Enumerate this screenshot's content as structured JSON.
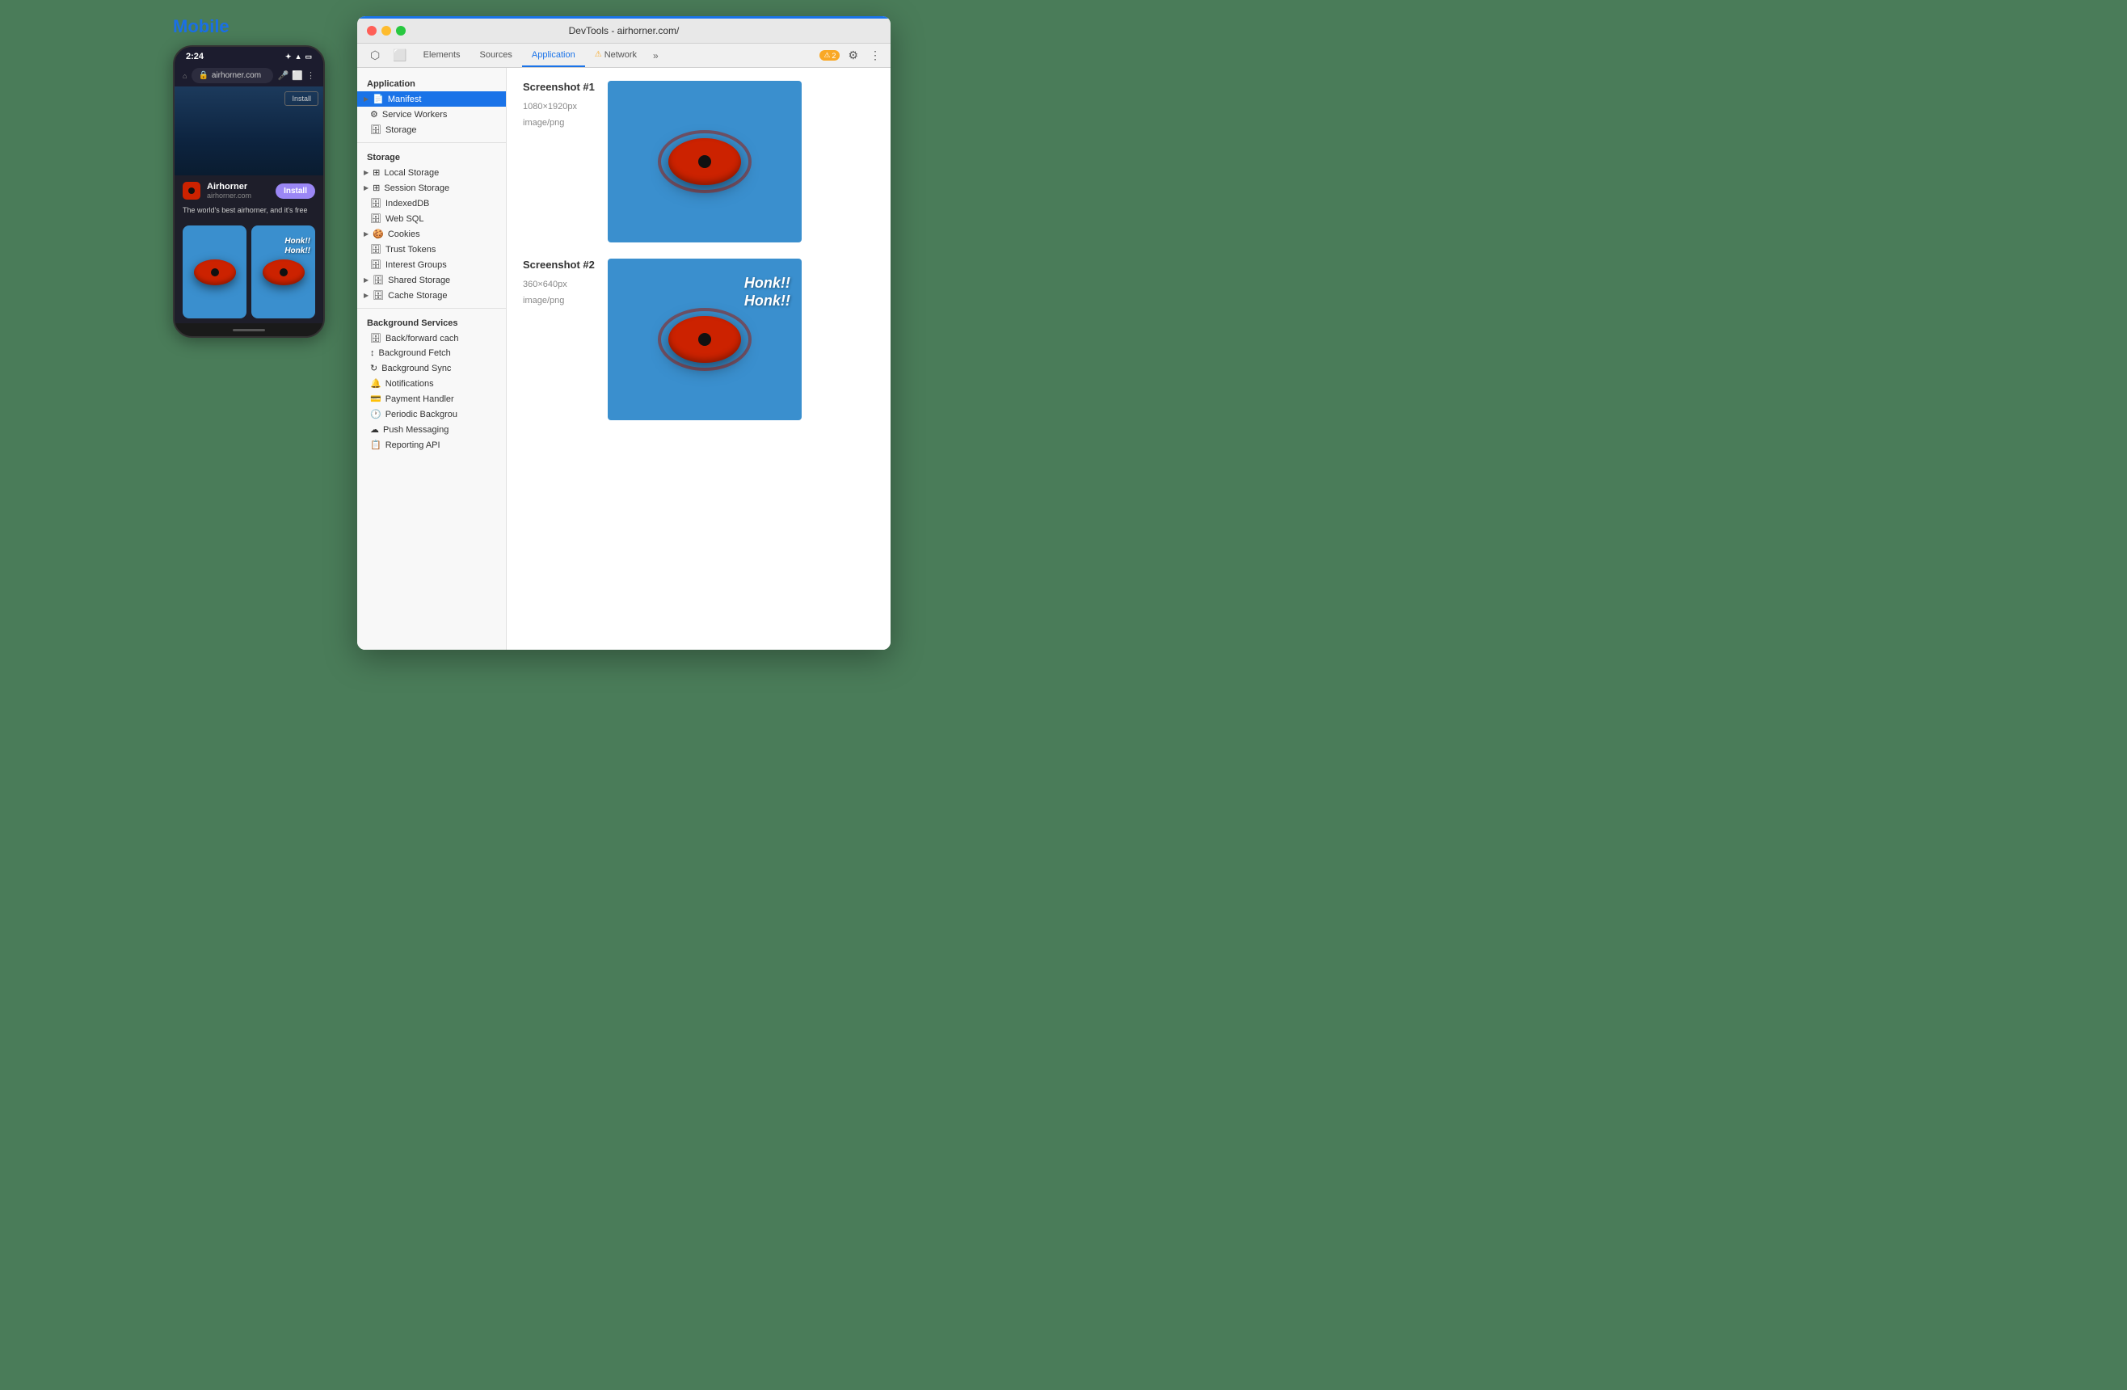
{
  "left": {
    "mobile_label": "Mobile",
    "phone": {
      "time": "2:24",
      "address": "airhorner.com",
      "install_top": "Install",
      "app_name": "Airhorner",
      "app_domain": "airhorner.com",
      "install_btn": "Install",
      "tagline": "The world's best airhorner, and it's free",
      "honk_text": "Honk!!\nHonk!!"
    }
  },
  "devtools": {
    "title": "DevTools - airhorner.com/",
    "tabs": [
      {
        "label": "Elements",
        "active": false
      },
      {
        "label": "Sources",
        "active": false
      },
      {
        "label": "Application",
        "active": true
      },
      {
        "label": "Network",
        "active": false,
        "warning": true
      }
    ],
    "more_tabs": "»",
    "warn_badge": "⚠ 2",
    "sidebar": {
      "sections": [
        {
          "label": "Application",
          "items": [
            {
              "label": "Manifest",
              "icon": "📄",
              "arrow": true,
              "active": true
            },
            {
              "label": "Service Workers",
              "icon": "⚙️",
              "arrow": false
            },
            {
              "label": "Storage",
              "icon": "🗄️",
              "arrow": false
            }
          ]
        },
        {
          "label": "Storage",
          "items": [
            {
              "label": "Local Storage",
              "icon": "▦",
              "arrow": true
            },
            {
              "label": "Session Storage",
              "icon": "▦",
              "arrow": true
            },
            {
              "label": "IndexedDB",
              "icon": "🗄️",
              "arrow": false
            },
            {
              "label": "Web SQL",
              "icon": "🗄️",
              "arrow": false
            },
            {
              "label": "Cookies",
              "icon": "🍪",
              "arrow": true
            },
            {
              "label": "Trust Tokens",
              "icon": "🗄️",
              "arrow": false
            },
            {
              "label": "Interest Groups",
              "icon": "🗄️",
              "arrow": false
            },
            {
              "label": "Shared Storage",
              "icon": "🗄️",
              "arrow": true
            },
            {
              "label": "Cache Storage",
              "icon": "🗄️",
              "arrow": true
            }
          ]
        },
        {
          "label": "Background Services",
          "items": [
            {
              "label": "Back/forward cach",
              "icon": "🗄️",
              "arrow": false
            },
            {
              "label": "Background Fetch",
              "icon": "↕",
              "arrow": false
            },
            {
              "label": "Background Sync",
              "icon": "🔄",
              "arrow": false
            },
            {
              "label": "Notifications",
              "icon": "🔔",
              "arrow": false
            },
            {
              "label": "Payment Handler",
              "icon": "💳",
              "arrow": false
            },
            {
              "label": "Periodic Backgrou",
              "icon": "🕐",
              "arrow": false
            },
            {
              "label": "Push Messaging",
              "icon": "☁️",
              "arrow": false
            },
            {
              "label": "Reporting API",
              "icon": "📋",
              "arrow": false
            }
          ]
        }
      ]
    },
    "main": {
      "screenshots": [
        {
          "title": "Screenshot #1",
          "size": "1080×1920px",
          "type": "image/png"
        },
        {
          "title": "Screenshot #2",
          "size": "360×640px",
          "type": "image/png"
        }
      ]
    }
  }
}
